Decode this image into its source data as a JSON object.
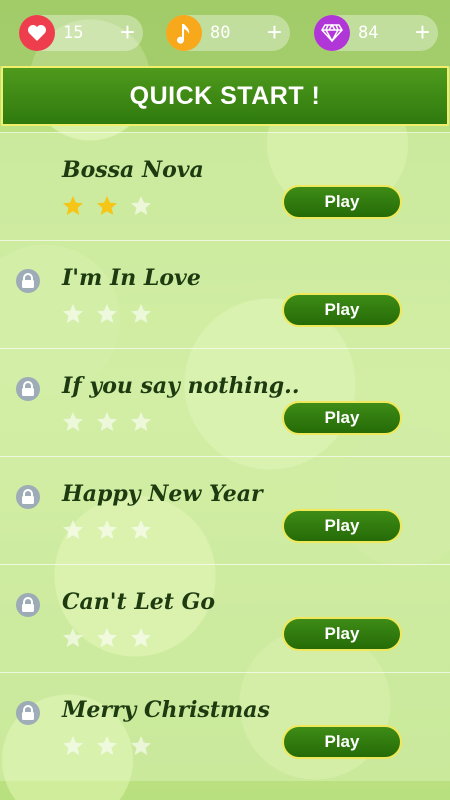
{
  "currencies": {
    "hearts": {
      "value": "15",
      "icon": "heart-icon",
      "color": "#ee3d4d"
    },
    "notes": {
      "value": "80",
      "icon": "music-note-icon",
      "color": "#f8a81b"
    },
    "gems": {
      "value": "84",
      "icon": "diamond-icon",
      "color": "#b136d8"
    },
    "plus_label": "+"
  },
  "quick_start": {
    "label": "QUICK START !"
  },
  "songs": [
    {
      "title": "Bossa Nova",
      "locked": false,
      "stars_earned": 2,
      "stars_total": 3,
      "play_label": "Play"
    },
    {
      "title": "I'm In Love",
      "locked": true,
      "stars_earned": 0,
      "stars_total": 3,
      "play_label": "Play"
    },
    {
      "title": "If you say nothing..",
      "locked": true,
      "stars_earned": 0,
      "stars_total": 3,
      "play_label": "Play"
    },
    {
      "title": "Happy New Year",
      "locked": true,
      "stars_earned": 0,
      "stars_total": 3,
      "play_label": "Play"
    },
    {
      "title": "Can't Let Go",
      "locked": true,
      "stars_earned": 0,
      "stars_total": 3,
      "play_label": "Play"
    },
    {
      "title": "Merry Christmas",
      "locked": true,
      "stars_earned": 0,
      "stars_total": 3,
      "play_label": "Play"
    }
  ],
  "colors": {
    "star_earned": "#f5c518",
    "star_empty": "#ffffff",
    "button_green": "#2f7a0e",
    "button_border": "#efe85a"
  }
}
